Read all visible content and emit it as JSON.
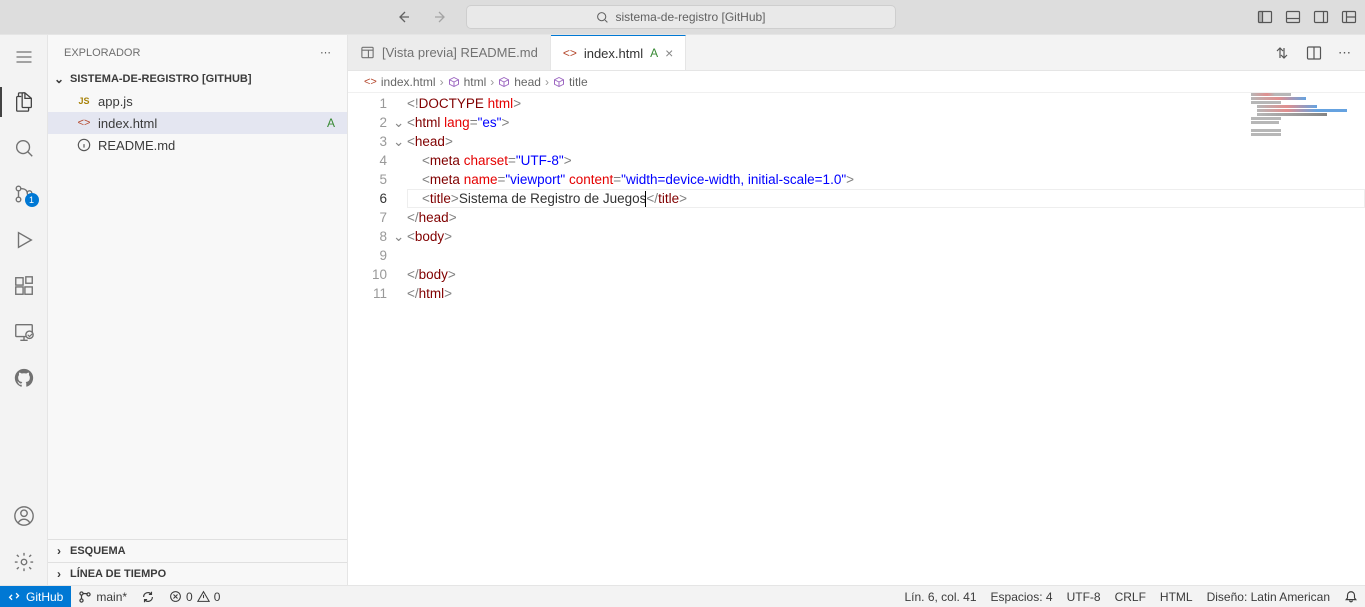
{
  "titlebar": {
    "search_text": "sistema-de-registro [GitHub]"
  },
  "sidebar": {
    "title": "EXPLORADOR",
    "project_name": "SISTEMA-DE-REGISTRO [GITHUB]",
    "files": [
      {
        "icon": "js",
        "label": "app.js",
        "status": ""
      },
      {
        "icon": "html",
        "label": "index.html",
        "status": "A",
        "selected": true
      },
      {
        "icon": "info",
        "label": "README.md",
        "status": ""
      }
    ],
    "collapsed_sections": [
      "ESQUEMA",
      "LÍNEA DE TIEMPO"
    ]
  },
  "scm_badge": "1",
  "tabs": [
    {
      "icon": "preview",
      "label": "[Vista previa] README.md",
      "active": false
    },
    {
      "icon": "html",
      "label": "index.html",
      "status": "A",
      "active": true
    }
  ],
  "breadcrumb": [
    {
      "icon": "html",
      "label": "index.html"
    },
    {
      "icon": "cube",
      "label": "html"
    },
    {
      "icon": "cube",
      "label": "head"
    },
    {
      "icon": "cube",
      "label": "title"
    }
  ],
  "code": {
    "lines": [
      {
        "n": 1,
        "fold": "",
        "tokens": [
          [
            "t-gray",
            "<!"
          ],
          [
            "t-brown",
            "DOCTYPE"
          ],
          [
            "t-gray",
            " "
          ],
          [
            "t-red",
            "html"
          ],
          [
            "t-gray",
            ">"
          ]
        ]
      },
      {
        "n": 2,
        "fold": "v",
        "tokens": [
          [
            "t-gray",
            "<"
          ],
          [
            "t-brown",
            "html"
          ],
          [
            "t-gray",
            " "
          ],
          [
            "t-red",
            "lang"
          ],
          [
            "t-gray",
            "="
          ],
          [
            "t-blue",
            "\"es\""
          ],
          [
            "t-gray",
            ">"
          ]
        ]
      },
      {
        "n": 3,
        "fold": "v",
        "tokens": [
          [
            "t-gray",
            "<"
          ],
          [
            "t-brown",
            "head"
          ],
          [
            "t-gray",
            ">"
          ]
        ]
      },
      {
        "n": 4,
        "fold": "",
        "indent": 2,
        "tokens": [
          [
            "t-gray",
            "<"
          ],
          [
            "t-brown",
            "meta"
          ],
          [
            "t-gray",
            " "
          ],
          [
            "t-red",
            "charset"
          ],
          [
            "t-gray",
            "="
          ],
          [
            "t-blue",
            "\"UTF-8\""
          ],
          [
            "t-gray",
            ">"
          ]
        ]
      },
      {
        "n": 5,
        "fold": "",
        "indent": 2,
        "tokens": [
          [
            "t-gray",
            "<"
          ],
          [
            "t-brown",
            "meta"
          ],
          [
            "t-gray",
            " "
          ],
          [
            "t-red",
            "name"
          ],
          [
            "t-gray",
            "="
          ],
          [
            "t-blue",
            "\"viewport\""
          ],
          [
            "t-gray",
            " "
          ],
          [
            "t-red",
            "content"
          ],
          [
            "t-gray",
            "="
          ],
          [
            "t-blue",
            "\"width=device-width, initial-scale=1.0\""
          ],
          [
            "t-gray",
            ">"
          ]
        ]
      },
      {
        "n": 6,
        "fold": "",
        "indent": 2,
        "current": true,
        "tokens": [
          [
            "t-gray",
            "<"
          ],
          [
            "t-brown",
            "title"
          ],
          [
            "t-gray",
            ">"
          ],
          [
            "t-black",
            "Sistema de Registro de Juegos"
          ],
          [
            "cursor",
            ""
          ],
          [
            "t-gray",
            "</"
          ],
          [
            "t-brown",
            "title"
          ],
          [
            "t-gray",
            ">"
          ]
        ]
      },
      {
        "n": 7,
        "fold": "",
        "tokens": [
          [
            "t-gray",
            "</"
          ],
          [
            "t-brown",
            "head"
          ],
          [
            "t-gray",
            ">"
          ]
        ]
      },
      {
        "n": 8,
        "fold": "v",
        "tokens": [
          [
            "t-gray",
            "<"
          ],
          [
            "t-brown",
            "body"
          ],
          [
            "t-gray",
            ">"
          ]
        ]
      },
      {
        "n": 9,
        "fold": "",
        "indent": 2,
        "tokens": []
      },
      {
        "n": 10,
        "fold": "",
        "tokens": [
          [
            "t-gray",
            "</"
          ],
          [
            "t-brown",
            "body"
          ],
          [
            "t-gray",
            ">"
          ]
        ]
      },
      {
        "n": 11,
        "fold": "",
        "tokens": [
          [
            "t-gray",
            "</"
          ],
          [
            "t-brown",
            "html"
          ],
          [
            "t-gray",
            ">"
          ]
        ]
      }
    ]
  },
  "statusbar": {
    "remote": "GitHub",
    "branch": "main*",
    "sync": "",
    "errors": "0",
    "warnings": "0",
    "cursor_pos": "Lín. 6, col. 41",
    "spaces": "Espacios: 4",
    "encoding": "UTF-8",
    "eol": "CRLF",
    "lang": "HTML",
    "layout_kb": "Diseño: Latin American"
  }
}
